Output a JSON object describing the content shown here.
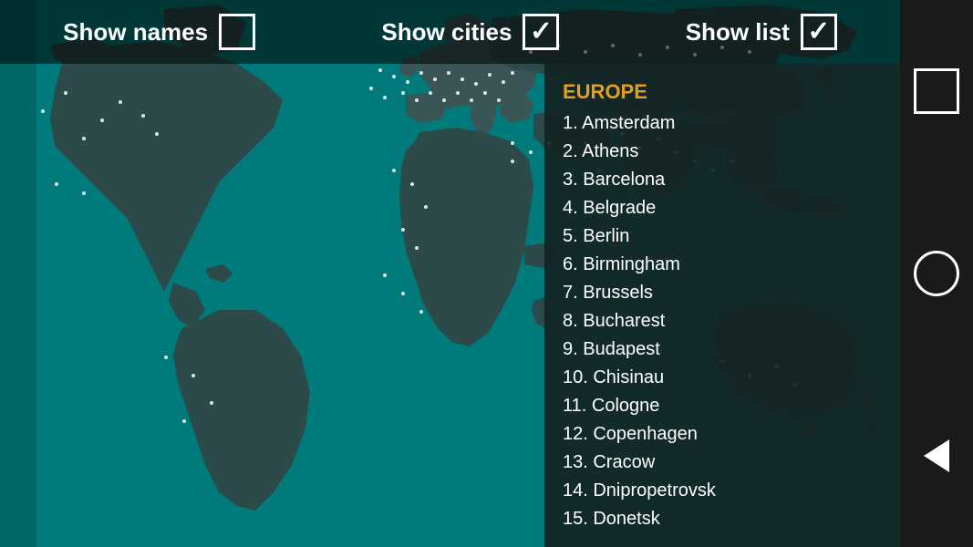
{
  "topBar": {
    "showNames": {
      "label": "Show names",
      "checked": false
    },
    "showCities": {
      "label": "Show cities",
      "checked": true
    },
    "showList": {
      "label": "Show list",
      "checked": true
    }
  },
  "cityList": {
    "region": "EUROPE",
    "cities": [
      {
        "number": 1,
        "name": "Amsterdam"
      },
      {
        "number": 2,
        "name": "Athens"
      },
      {
        "number": 3,
        "name": "Barcelona"
      },
      {
        "number": 4,
        "name": "Belgrade"
      },
      {
        "number": 5,
        "name": "Berlin"
      },
      {
        "number": 6,
        "name": "Birmingham"
      },
      {
        "number": 7,
        "name": "Brussels"
      },
      {
        "number": 8,
        "name": "Bucharest"
      },
      {
        "number": 9,
        "name": "Budapest"
      },
      {
        "number": 10,
        "name": "Chisinau"
      },
      {
        "number": 11,
        "name": "Cologne"
      },
      {
        "number": 12,
        "name": "Copenhagen"
      },
      {
        "number": 13,
        "name": "Cracow"
      },
      {
        "number": 14,
        "name": "Dnipropetrovsk"
      },
      {
        "number": 15,
        "name": "Donetsk"
      }
    ]
  },
  "navButtons": {
    "square": "□",
    "circle": "○",
    "back": "◁"
  },
  "colors": {
    "mapBg": "#006666",
    "landDark": "#2a3a3a",
    "panelBg": "rgba(20,35,35,0.92)",
    "regionColor": "#e0a020",
    "textColor": "#ffffff"
  }
}
